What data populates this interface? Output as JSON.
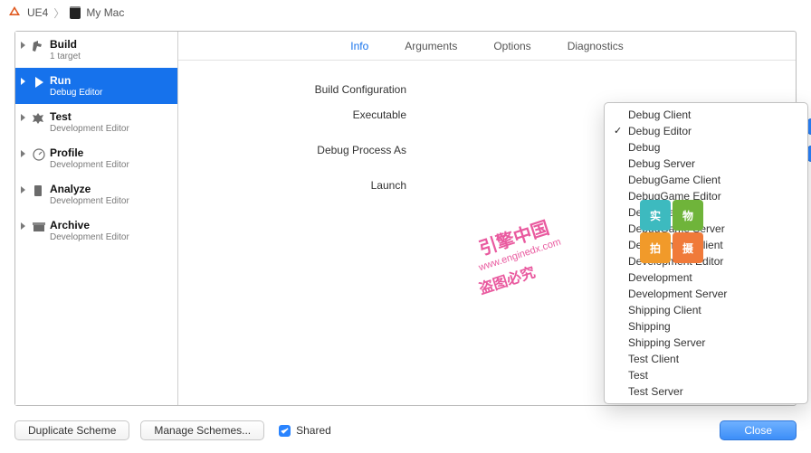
{
  "crumb": {
    "project": "UE4",
    "device": "My Mac"
  },
  "sidebar": [
    {
      "title": "Build",
      "sub": "1 target"
    },
    {
      "title": "Run",
      "sub": "Debug Editor",
      "selected": true
    },
    {
      "title": "Test",
      "sub": "Development Editor"
    },
    {
      "title": "Profile",
      "sub": "Development Editor"
    },
    {
      "title": "Analyze",
      "sub": "Development Editor"
    },
    {
      "title": "Archive",
      "sub": "Development Editor"
    }
  ],
  "tabs": {
    "info": "Info",
    "arguments": "Arguments",
    "options": "Options",
    "diagnostics": "Diagnostics",
    "active": "info"
  },
  "labels": {
    "buildConfig": "Build Configuration",
    "executable": "Executable",
    "debugProcessAs": "Debug Process As",
    "launch": "Launch"
  },
  "config_menu": {
    "selected": "Debug Editor",
    "items": [
      "Debug Client",
      "Debug Editor",
      "Debug",
      "Debug Server",
      "DebugGame Client",
      "DebugGame Editor",
      "DebugGame",
      "DebugGame Server",
      "Development Client",
      "Development Editor",
      "Development",
      "Development Server",
      "Shipping Client",
      "Shipping",
      "Shipping Server",
      "Test Client",
      "Test",
      "Test Server"
    ]
  },
  "bottom": {
    "duplicate": "Duplicate Scheme",
    "manage": "Manage Schemes...",
    "shared_label": "Shared",
    "shared_checked": true,
    "close": "Close"
  },
  "watermark": {
    "line1": "引擎中国",
    "line2": "盗图必究",
    "url": "www.enginedx.com",
    "tiles": [
      "实",
      "物",
      "拍",
      "摄"
    ]
  }
}
